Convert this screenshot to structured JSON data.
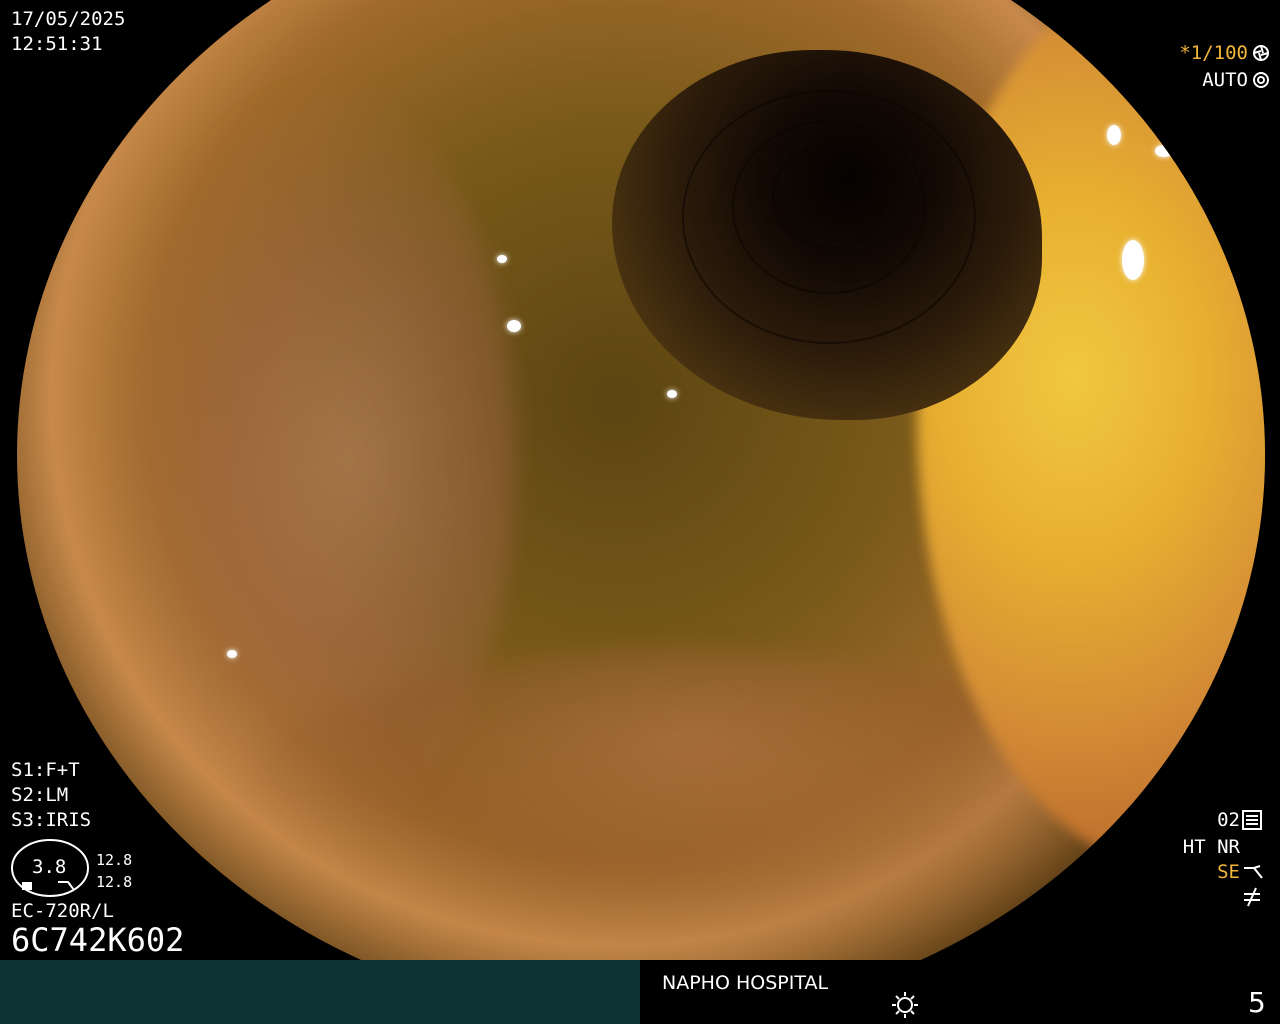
{
  "overlay": {
    "date": "17/05/2025",
    "time": "12:51:31",
    "shutter": "*1/100",
    "exposure_mode": "AUTO",
    "s1": "S1:F+T",
    "s2": "S2:LM",
    "s3": "S3:IRIS",
    "iris_value": "3.8",
    "value_top": "12.8",
    "value_bottom": "12.8",
    "scope_model": "EC-720R/L",
    "serial": "6C742K602",
    "right_mode": "02",
    "ht_nr": "HT NR",
    "se": "SE"
  },
  "footer": {
    "hospital": "NAPHO HOSPITAL",
    "page_number": "5"
  },
  "icons": [
    "shutter-icon",
    "auto-exposure-icon",
    "settings-icon",
    "structure-enhance-icon",
    "filter-icon",
    "brightness-icon"
  ],
  "colors": {
    "accent_orange": "#f3b63a",
    "footer_left": "#0f3436"
  }
}
